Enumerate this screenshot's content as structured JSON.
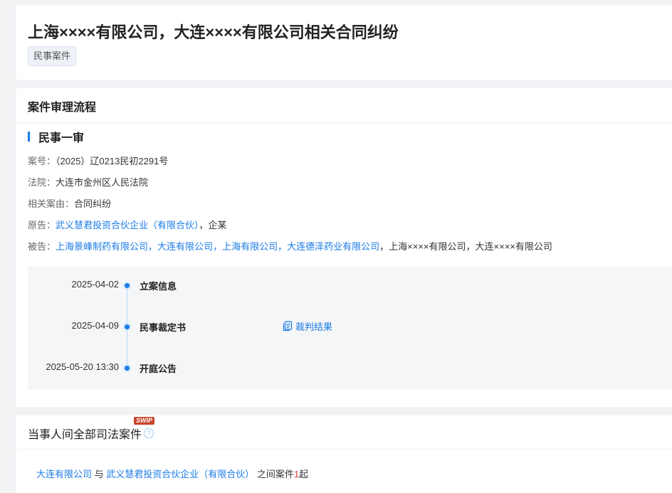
{
  "case": {
    "title": "上海××××有限公司，大连××××有限公司相关合同纠纷",
    "tag": "民事案件"
  },
  "flow": {
    "heading": "案件审理流程",
    "stage": "民事一审",
    "case_no": {
      "label": "案号：",
      "value": "（2025）辽0213民初2291号"
    },
    "court": {
      "label": "法院：",
      "value": "大连市金州区人民法院"
    },
    "cause": {
      "label": "相关案由：",
      "value": "合同纠纷"
    },
    "plaintiff": {
      "label": "原告：",
      "link": "武义慧君投资合伙企业（有限合伙）",
      "sep": "，",
      "text": "企某"
    },
    "defendant": {
      "label": "被告：",
      "links": [
        "上海景峰制药有限公司",
        "大连有限公司",
        "上海有限公司",
        "大连德泽药业有限公司"
      ],
      "sep": "，",
      "text": "上海××××有限公司，大连××××有限公司"
    },
    "timeline": [
      {
        "date": "2025-04-02",
        "label": "立案信息",
        "action": ""
      },
      {
        "date": "2025-04-09",
        "label": "民事裁定书",
        "action": "裁判结果"
      },
      {
        "date": "2025-05-20 13:30",
        "label": "开庭公告",
        "action": ""
      }
    ]
  },
  "related": {
    "heading": "当事人间全部司法案件",
    "badge": "SWIP",
    "party_a": "大连有限公司",
    "conj": "与",
    "party_b": "武义慧君投资合伙企业（有限合伙）",
    "suffix": "之间案件",
    "count": "1",
    "unit": "起"
  },
  "colors": {
    "accent": "#1a7be6",
    "count": "#d8382c",
    "badge": "#c9432a"
  },
  "icons": {
    "doc": "document-icon",
    "help": "help-icon"
  }
}
